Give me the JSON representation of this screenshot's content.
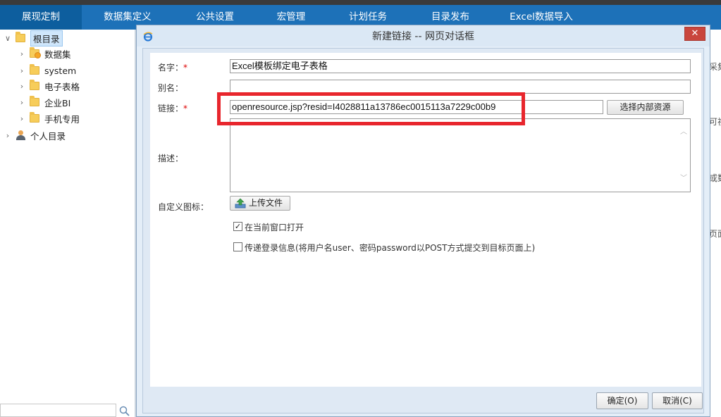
{
  "nav": {
    "items": [
      "展现定制",
      "数据集定义",
      "公共设置",
      "宏管理",
      "计划任务",
      "目录发布",
      "Excel数据导入"
    ]
  },
  "tree": {
    "root": "根目录",
    "children": [
      "数据集",
      "system",
      "电子表格",
      "企业BI",
      "手机专用"
    ],
    "personal": "个人目录",
    "search_placeholder": ""
  },
  "background_fragments": [
    "采集",
    "可视",
    "或数",
    "页面"
  ],
  "dialog": {
    "title": "新建链接 -- 网页对话框",
    "close_label": "✕",
    "name_label": "名字：",
    "name_value": "Excel模板绑定电子表格",
    "alias_label": "别名：",
    "alias_value": "",
    "link_label": "链接：",
    "link_value": "openresource.jsp?resid=I4028811a13786ec0015113a7229c00b9",
    "select_resource_label": "选择内部资源",
    "desc_label": "描述：",
    "desc_value": "",
    "icon_label": "自定义图标：",
    "upload_label": "上传文件",
    "open_current_label": "在当前窗口打开",
    "open_current_checked": true,
    "pass_login_label": "传递登录信息(将用户名user、密码password以POST方式提交到目标页面上)",
    "pass_login_checked": false,
    "ok_label": "确定(O)",
    "cancel_label": "取消(C)",
    "required_mark": "*"
  },
  "colors": {
    "nav_bg": "#1d71b8",
    "nav_active": "#0d5e9e",
    "highlight_box": "#e8262d",
    "close_btn": "#c9463d"
  }
}
